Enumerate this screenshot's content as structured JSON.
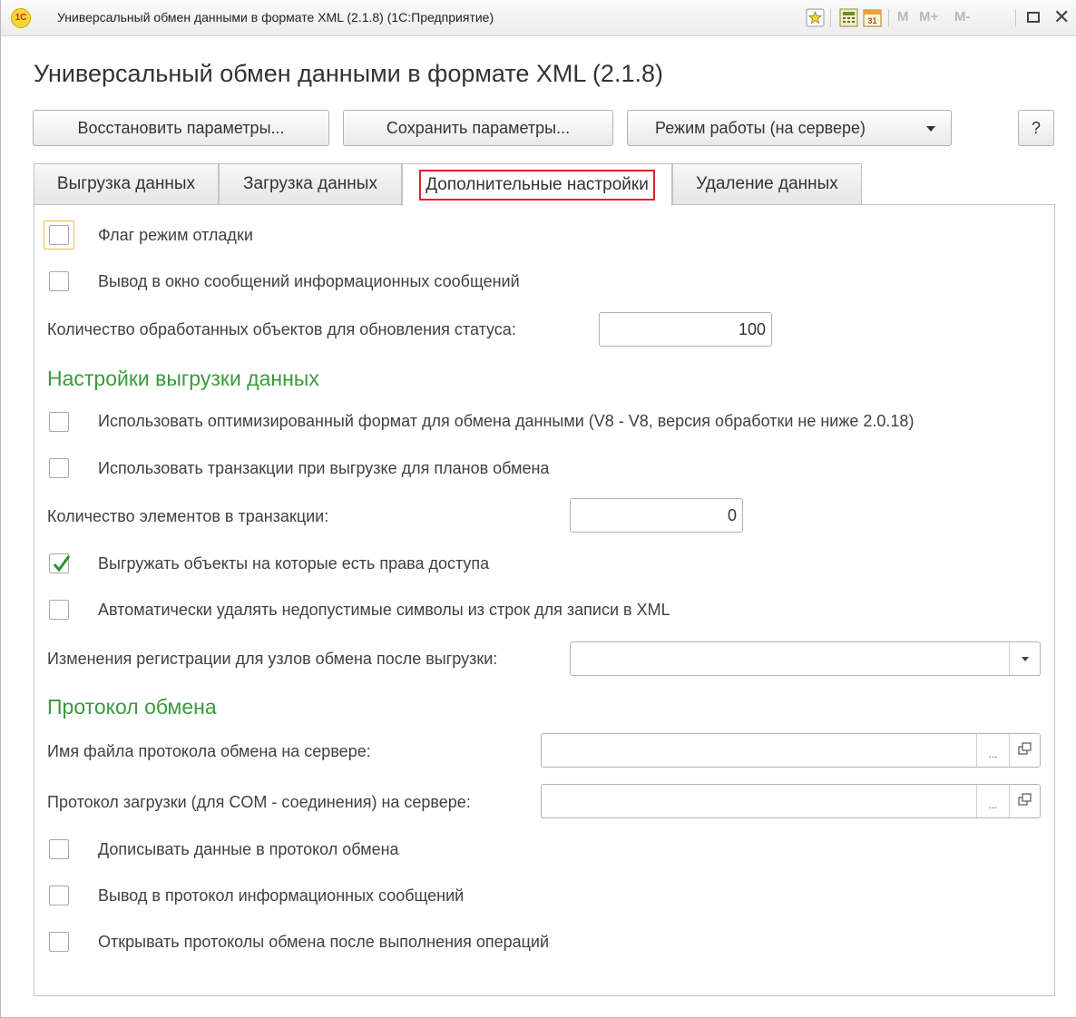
{
  "window": {
    "title": "Универсальный обмен данными в формате XML (2.1.8)  (1С:Предприятие)",
    "logo_text": "1С",
    "mem_buttons": [
      "M",
      "M+",
      "M-"
    ],
    "icons": [
      "favorites-star-icon",
      "calculator-icon",
      "calendar-icon",
      "maximize-icon",
      "close-icon"
    ]
  },
  "form": {
    "title": "Универсальный обмен данными в формате XML (2.1.8)",
    "buttons": {
      "restore": "Восстановить параметры...",
      "save": "Сохранить параметры...",
      "mode": "Режим работы (на сервере)",
      "help": "?"
    },
    "tabs": [
      {
        "label": "Выгрузка данных",
        "active": false
      },
      {
        "label": "Загрузка данных",
        "active": false
      },
      {
        "label": "Дополнительные настройки",
        "active": true
      },
      {
        "label": "Удаление данных",
        "active": false
      }
    ]
  },
  "settings": {
    "debug_flag": {
      "label": "Флаг режим отладки",
      "checked": false
    },
    "info_messages": {
      "label": "Вывод в окно сообщений информационных сообщений",
      "checked": false
    },
    "status_count": {
      "label": "Количество обработанных объектов для обновления статуса:",
      "value": "100"
    }
  },
  "export_section": {
    "heading": "Настройки выгрузки данных",
    "optimized_format": {
      "label": "Использовать оптимизированный формат для обмена данными (V8 - V8, версия обработки не ниже 2.0.18)",
      "checked": false
    },
    "use_transactions": {
      "label": "Использовать транзакции при выгрузке для планов обмена",
      "checked": false
    },
    "tx_count": {
      "label": "Количество элементов в транзакции:",
      "value": "0"
    },
    "access_rights": {
      "label": "Выгружать объекты на которые есть права доступа",
      "checked": true
    },
    "strip_symbols": {
      "label": "Автоматически удалять недопустимые символы из строк для записи в XML",
      "checked": false
    },
    "registration_change": {
      "label": "Изменения регистрации для узлов обмена после выгрузки:",
      "value": ""
    }
  },
  "protocol_section": {
    "heading": "Протокол обмена",
    "server_file": {
      "label": "Имя файла протокола обмена на сервере:",
      "value": "",
      "dots": "..."
    },
    "com_protocol": {
      "label": "Протокол загрузки (для COM - соединения) на сервере:",
      "value": "",
      "dots": "..."
    },
    "append": {
      "label": "Дописывать данные в протокол обмена",
      "checked": false
    },
    "info_to_protocol": {
      "label": "Вывод в протокол информационных сообщений",
      "checked": false
    },
    "open_after": {
      "label": "Открывать протоколы обмена после выполнения операций",
      "checked": false
    }
  },
  "colors": {
    "section_heading": "#3a9a3c",
    "active_tab_outline": "#e0202a",
    "check_mark": "#2f8f2f",
    "focus_outline": "#e7c044"
  }
}
